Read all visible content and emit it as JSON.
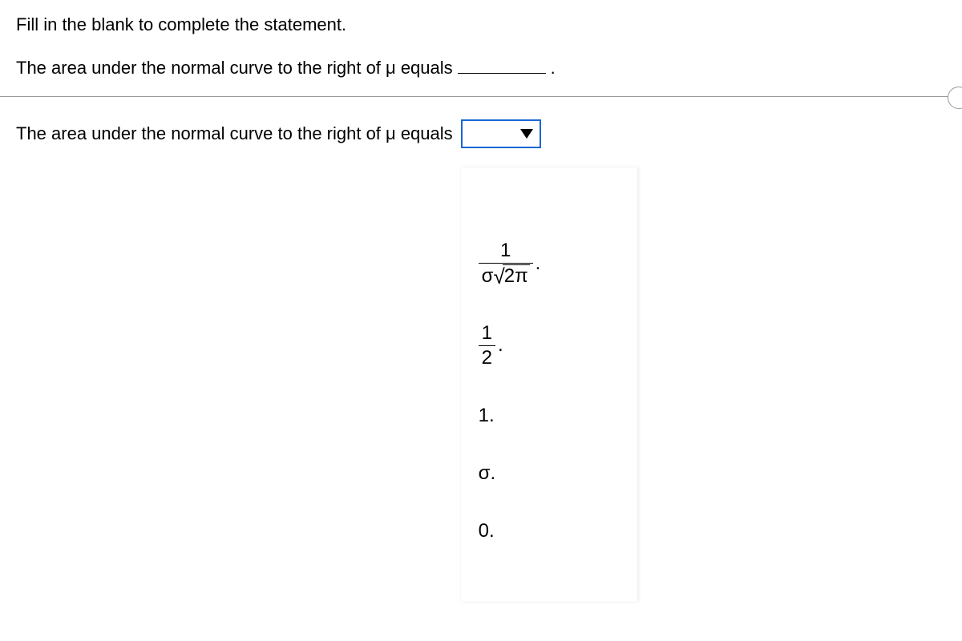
{
  "prompt": {
    "instruction": "Fill in the blank to complete the statement.",
    "statement_prefix": "The area under the normal curve to the right of μ equals",
    "statement_suffix": "."
  },
  "answer_row": {
    "text": "The area under the normal curve to the right of μ equals"
  },
  "dropdown": {
    "selected": "",
    "options": {
      "opt1_num": "1",
      "opt1_den_sigma": "σ",
      "opt1_den_radicand": "2π",
      "opt2_num": "1",
      "opt2_den": "2",
      "opt3": "1.",
      "opt4": "σ.",
      "opt5": "0."
    }
  }
}
